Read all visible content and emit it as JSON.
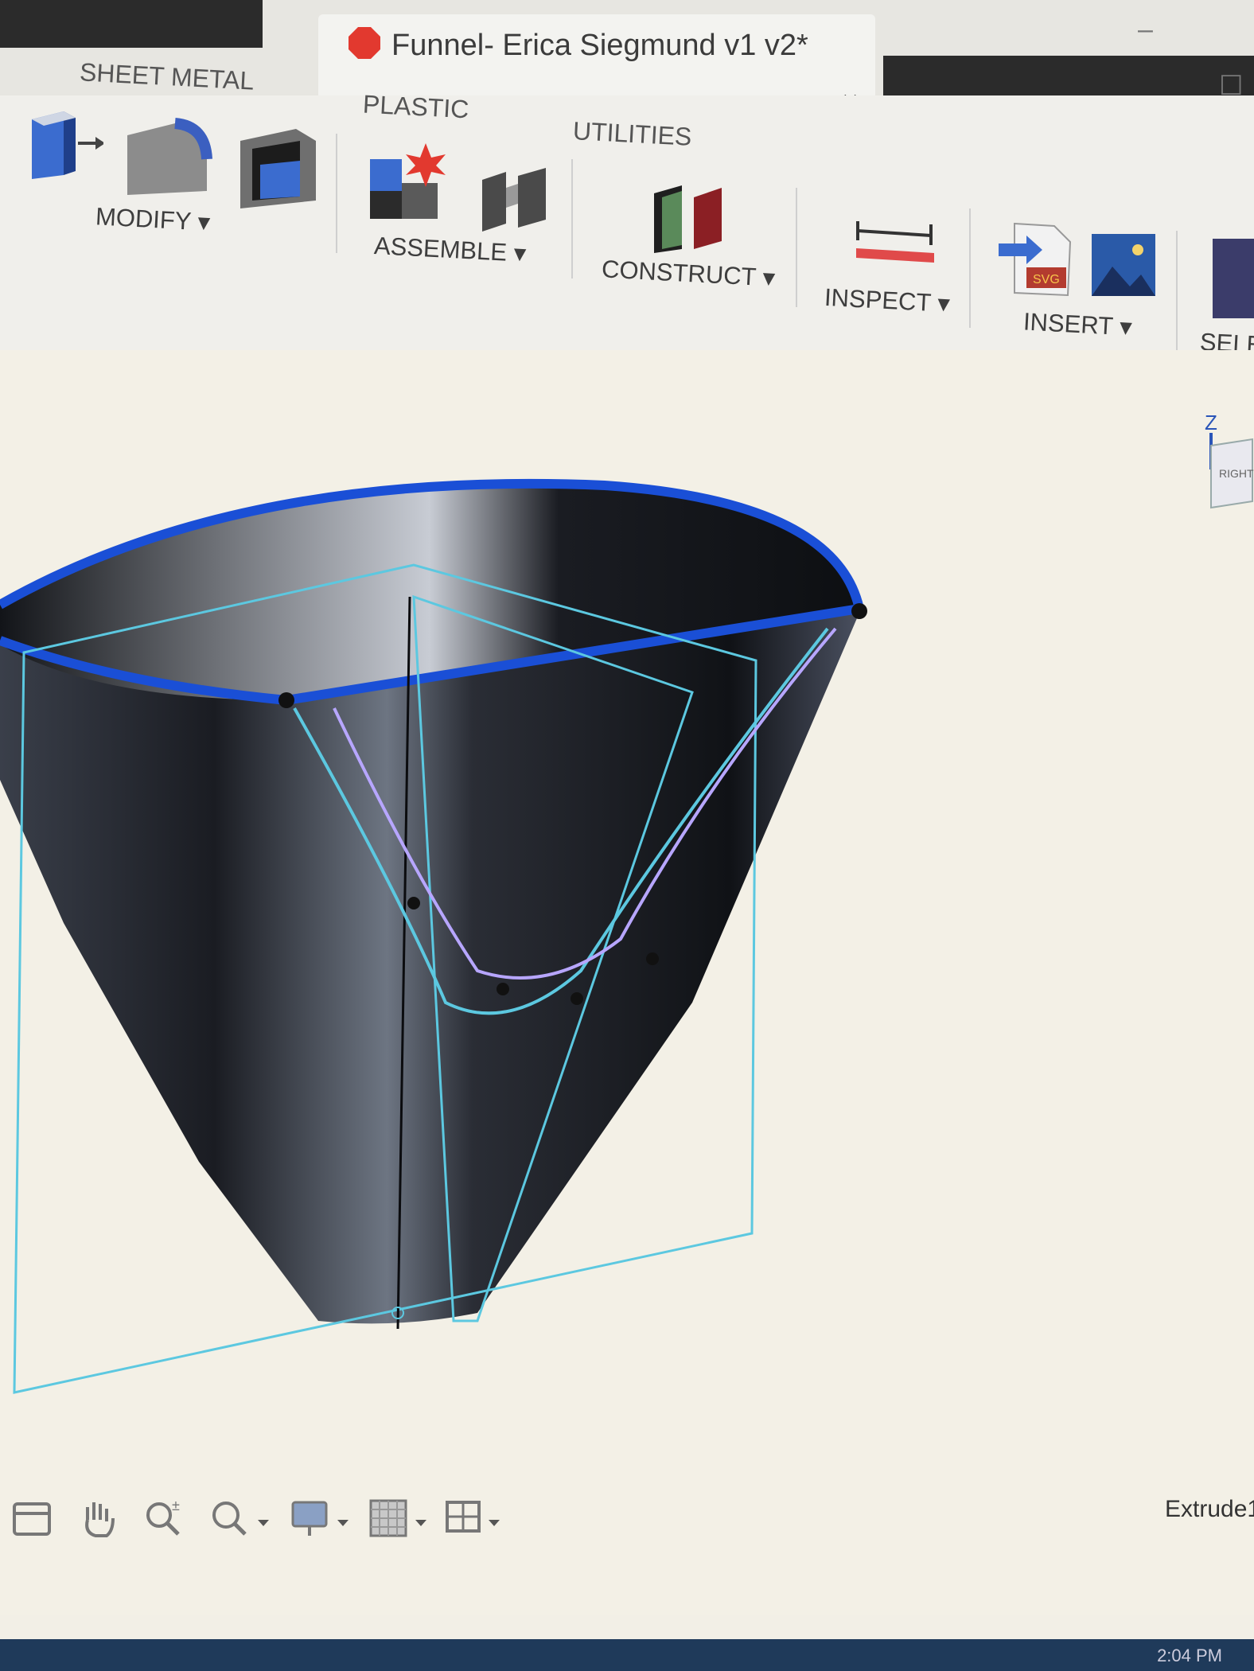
{
  "window": {
    "title": "Funnel- Erica Siegmund v1 v2*",
    "close_glyph": "×",
    "minimize_glyph": "–",
    "maximize_glyph": "☐"
  },
  "ribbon": {
    "tabs": [
      "SHEET METAL",
      "PLASTIC",
      "UTILITIES"
    ],
    "groups": {
      "modify": "MODIFY ▾",
      "assemble": "ASSEMBLE ▾",
      "construct": "CONSTRUCT ▾",
      "inspect": "INSPECT ▾",
      "insert": "INSERT ▾",
      "select": "SELE"
    },
    "insert_svg_badge": "SVG"
  },
  "viewcube": {
    "axis_label": "Z",
    "face_label": "RIGHT"
  },
  "navigation_bar": {
    "icons": [
      "browser-icon",
      "pan-hand-icon",
      "zoom-icon",
      "fit-zoom-icon",
      "display-settings-icon",
      "grid-settings-icon",
      "viewports-icon"
    ]
  },
  "status": {
    "feature_name": "Extrude1",
    "clock": "2:04 PM"
  },
  "colors": {
    "accent_blue": "#1a4fd6",
    "sketch_cyan": "#5cc8e0",
    "sketch_violet": "#b7a6ff",
    "body_dark": "#1a1c22"
  }
}
